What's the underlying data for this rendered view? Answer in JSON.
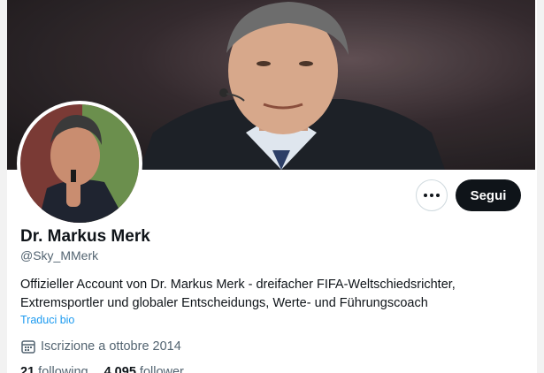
{
  "profile": {
    "name": "Dr. Markus Merk",
    "handle": "@Sky_MMerk",
    "bio": "Offizieller Account von Dr. Markus Merk - dreifacher FIFA-Weltschiedsrichter, Extremsportler und globaler Entscheidungs, Werte- und Führungscoach",
    "translate_label": "Traduci bio",
    "joined": "Iscrizione a ottobre 2014",
    "following_count": "21",
    "following_label": "following",
    "followers_count": "4.095",
    "followers_label": "follower"
  },
  "actions": {
    "follow_label": "Segui",
    "more_icon": "more-horizontal-icon"
  },
  "icons": {
    "calendar": "calendar-icon"
  },
  "colors": {
    "primary_text": "#0f1419",
    "secondary_text": "#536471",
    "link": "#1d9bf0",
    "button_bg": "#0f1419"
  }
}
